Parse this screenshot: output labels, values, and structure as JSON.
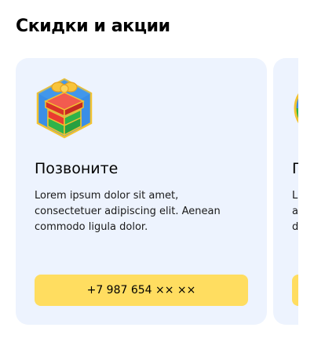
{
  "section": {
    "title": "Скидки и акции"
  },
  "cards": [
    {
      "icon": "gift-box-icon",
      "title": "Позвоните",
      "text": "Lorem ipsum dolor sit amet, consectetuer adipiscing elit. Aenean commodo ligula dolor.",
      "button_label": "+7 987 654 ×× ××"
    },
    {
      "icon": "promo-badge-icon",
      "title": "П",
      "text": "L\na\nd",
      "button_label": ""
    }
  ],
  "colors": {
    "card_background": "#edf3fe",
    "button_background": "#ffdd60",
    "icon_hexagon": "#3a8ee6",
    "icon_hexagon_border": "#f2c230",
    "icon_box_red": "#ea3b31",
    "icon_box_green": "#2fb34a",
    "icon_bow": "#f8c43a"
  }
}
